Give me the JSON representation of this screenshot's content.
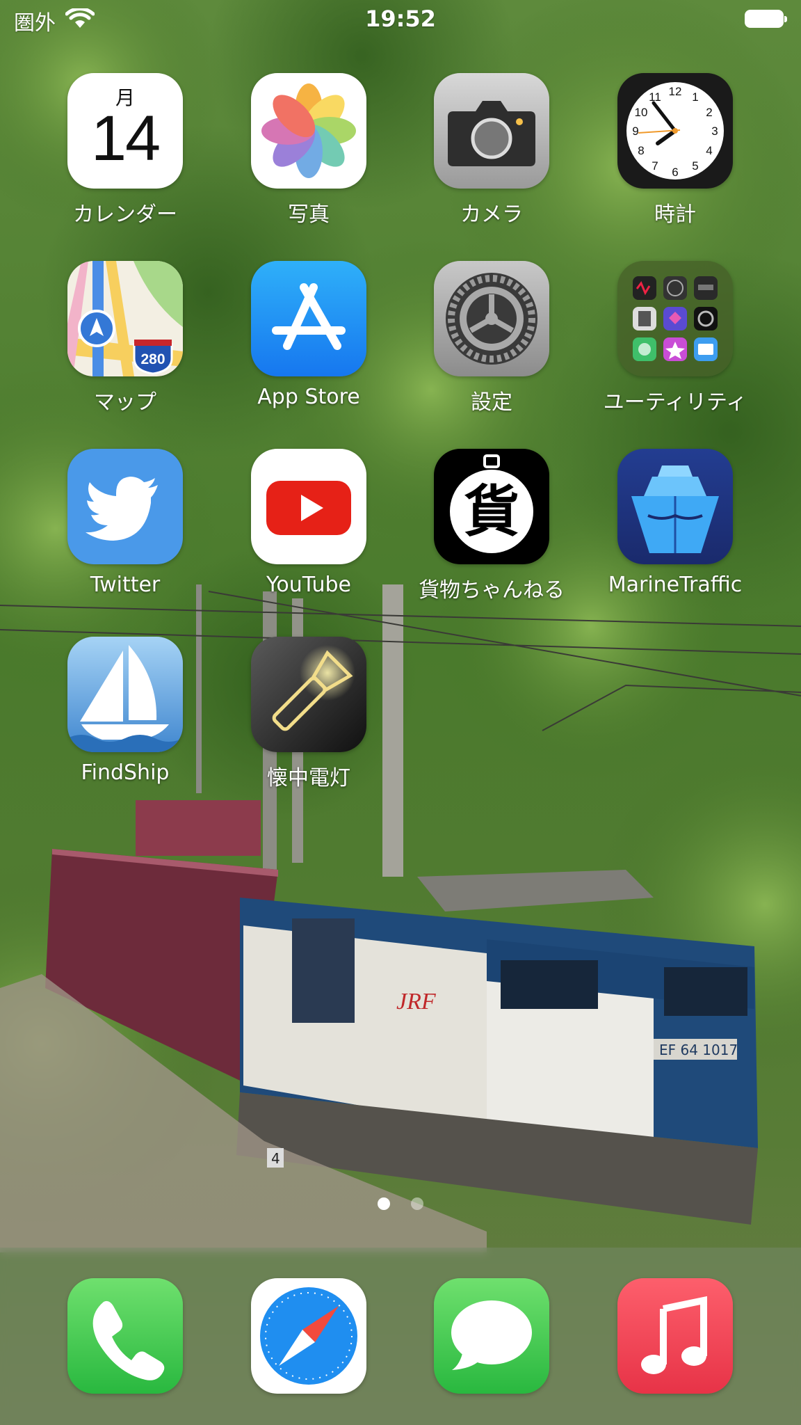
{
  "status_bar": {
    "carrier": "圏外",
    "time": "19:52",
    "wifi_icon": "wifi-icon",
    "battery_icon": "battery-icon"
  },
  "calendar_icon": {
    "month": "月",
    "day": "14"
  },
  "apps": [
    {
      "label": "カレンダー",
      "icon": "calendar-icon"
    },
    {
      "label": "写真",
      "icon": "photos-icon"
    },
    {
      "label": "カメラ",
      "icon": "camera-icon"
    },
    {
      "label": "時計",
      "icon": "clock-icon"
    },
    {
      "label": "マップ",
      "icon": "maps-icon"
    },
    {
      "label": "App Store",
      "icon": "app-store-icon"
    },
    {
      "label": "設定",
      "icon": "settings-icon"
    },
    {
      "label": "ユーティリティ",
      "icon": "utilities-folder-icon"
    },
    {
      "label": "Twitter",
      "icon": "twitter-icon"
    },
    {
      "label": "YouTube",
      "icon": "youtube-icon"
    },
    {
      "label": "貨物ちゃんねる",
      "icon": "freight-channel-icon"
    },
    {
      "label": "MarineTraffic",
      "icon": "marinetraffic-icon"
    },
    {
      "label": "FindShip",
      "icon": "findship-icon"
    },
    {
      "label": "懐中電灯",
      "icon": "flashlight-icon"
    }
  ],
  "maps_shield_number": "280",
  "freight_glyph": "貨",
  "page_dots": {
    "count": 2,
    "active": 1
  },
  "dock": [
    {
      "name": "Phone",
      "icon": "phone-icon"
    },
    {
      "name": "Safari",
      "icon": "safari-icon"
    },
    {
      "name": "Messages",
      "icon": "messages-icon"
    },
    {
      "name": "Music",
      "icon": "music-icon"
    }
  ],
  "wallpaper": {
    "locomotive_number": "EF 64 1017",
    "locomotive_logo": "JRF",
    "kilometer_post": "4"
  },
  "colors": {
    "twitter": "#4a99e9",
    "youtube": "#e62117",
    "appstore": "#1b8cf6",
    "phone": "#34c759",
    "music": "#fb3c4d"
  }
}
